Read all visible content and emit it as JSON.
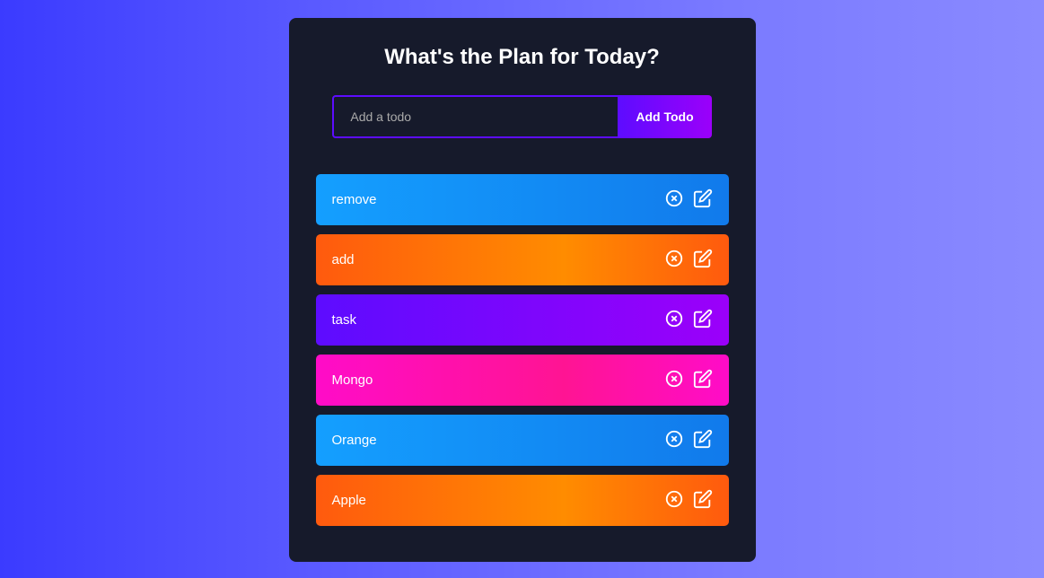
{
  "heading": "What's the Plan for Today?",
  "input": {
    "placeholder": "Add a todo",
    "value": ""
  },
  "addButtonLabel": "Add Todo",
  "todos": [
    {
      "text": "remove",
      "color": "blue"
    },
    {
      "text": "add",
      "color": "orange"
    },
    {
      "text": "task",
      "color": "purple"
    },
    {
      "text": "Mongo",
      "color": "pink"
    },
    {
      "text": "Orange",
      "color": "blue"
    },
    {
      "text": "Apple",
      "color": "orange"
    }
  ]
}
